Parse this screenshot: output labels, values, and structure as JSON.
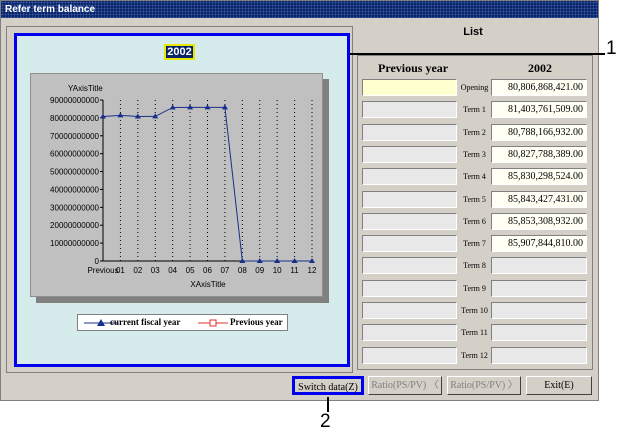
{
  "window": {
    "title": "Refer term balance"
  },
  "chart_panel": {
    "year_label": "2002"
  },
  "chart_data": {
    "type": "line",
    "title": "2002",
    "xlabel": "XAxisTitle",
    "ylabel": "YAxisTitle",
    "categories": [
      "Previous",
      "01",
      "02",
      "03",
      "04",
      "05",
      "06",
      "07",
      "08",
      "09",
      "10",
      "11",
      "12"
    ],
    "ylim": [
      0,
      90000000000
    ],
    "yticks": [
      "90000000000",
      "80000000000",
      "70000000000",
      "60000000000",
      "50000000000",
      "40000000000",
      "30000000000",
      "20000000000",
      "10000000000",
      "0"
    ],
    "series": [
      {
        "name": "current fiscal year",
        "color": "#1a2f8a",
        "marker": "triangle",
        "values": [
          80806868421,
          81403761509,
          80788166932,
          80827788389,
          85830298524,
          85843427431,
          85853308932,
          85907844810,
          0,
          0,
          0,
          0,
          0
        ]
      },
      {
        "name": "Previous year",
        "color": "#e03030",
        "marker": "square",
        "values": []
      }
    ],
    "grid": "vertical dotted",
    "legend": "bottom"
  },
  "list": {
    "title": "List",
    "col_prev": "Previous year",
    "col_cur": "2002",
    "rows": [
      {
        "term": "Opening",
        "prev": "",
        "cur": "80,806,868,421.00"
      },
      {
        "term": "Term 1",
        "prev": "",
        "cur": "81,403,761,509.00"
      },
      {
        "term": "Term 2",
        "prev": "",
        "cur": "80,788,166,932.00"
      },
      {
        "term": "Term 3",
        "prev": "",
        "cur": "80,827,788,389.00"
      },
      {
        "term": "Term 4",
        "prev": "",
        "cur": "85,830,298,524.00"
      },
      {
        "term": "Term 5",
        "prev": "",
        "cur": "85,843,427,431.00"
      },
      {
        "term": "Term 6",
        "prev": "",
        "cur": "85,853,308,932.00"
      },
      {
        "term": "Term 7",
        "prev": "",
        "cur": "85,907,844,810.00"
      },
      {
        "term": "Term 8",
        "prev": "",
        "cur": ""
      },
      {
        "term": "Term 9",
        "prev": "",
        "cur": ""
      },
      {
        "term": "Term 10",
        "prev": "",
        "cur": ""
      },
      {
        "term": "Term 11",
        "prev": "",
        "cur": ""
      },
      {
        "term": "Term 12",
        "prev": "",
        "cur": ""
      }
    ]
  },
  "buttons": {
    "switch": "Switch data(Z)",
    "ratio1": "Ratio(PS/PV)",
    "ratio2": "Ratio(PS/PV)",
    "exit": "Exit(E)"
  },
  "callouts": {
    "one": "1",
    "two": "2"
  }
}
